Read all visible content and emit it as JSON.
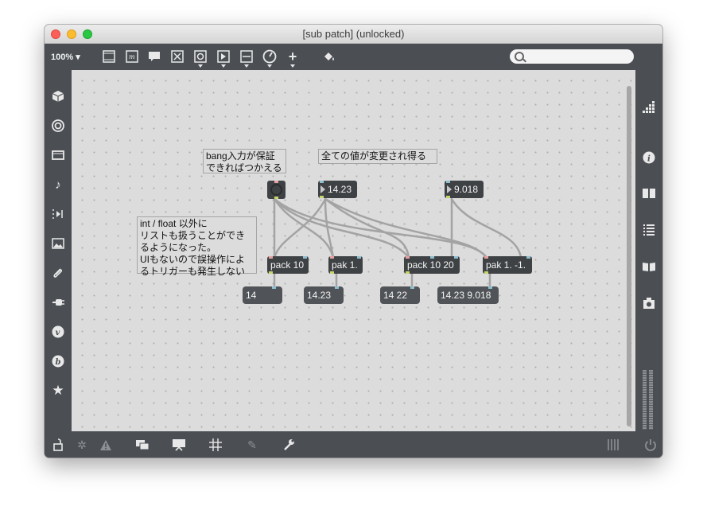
{
  "window": {
    "title": "[sub patch] (unlocked)"
  },
  "toolbar": {
    "zoom_label": "100%",
    "icons": [
      "presentation-view-icon",
      "message-object-icon",
      "comment-icon",
      "toggle-icon",
      "button-icon",
      "playbar-icon",
      "slider-icon",
      "dial-icon",
      "add-object-icon",
      "paint-bucket-icon"
    ],
    "search_placeholder": ""
  },
  "left_sidebar": {
    "icons": [
      "object-cube-icon",
      "circle-target-icon",
      "film-media-icon",
      "music-note-icon",
      "playlist-icon",
      "image-icon",
      "paperclip-icon",
      "plug-icon",
      "vizzie-icon",
      "beap-icon",
      "star-favorites-icon"
    ]
  },
  "right_sidebar": {
    "icons": [
      "grid-dots-icon",
      "info-icon",
      "reference-book-icon",
      "list-icon",
      "docs-book-icon",
      "snapshot-camera-icon"
    ]
  },
  "bottom_bar": {
    "icons": [
      "lock-icon",
      "debug-icon",
      "warning-icon",
      "window-stack-icon",
      "presentation-icon",
      "grid-icon",
      "edit-tag-icon",
      "wrench-icon",
      "mixer-icon",
      "power-icon"
    ]
  },
  "patch": {
    "comments": [
      {
        "id": "c1",
        "text": "bang入力が保証\nできればつかえる"
      },
      {
        "id": "c2",
        "text": "全ての値が変更され得る"
      },
      {
        "id": "c3",
        "text": "int / float 以外に\nリストも扱うことができ\nるようになった。\nUIもないので誤操作によ\nるトリガーも発生しない"
      }
    ],
    "objects": {
      "number_1": "14.23",
      "number_2": "9.018",
      "pack_10": "pack 10",
      "pak_1": "pak 1.",
      "pack_10_20": "pack 10 20",
      "pak_1_neg1": "pak 1. -1.",
      "msg_1": "14",
      "msg_2": "14.23",
      "msg_3": "14 22",
      "msg_4": "14.23 9.018"
    }
  },
  "colors": {
    "canvas": "#dcdcdc",
    "chrome": "#4b4f54",
    "object": "#3f4245",
    "cord": "#a8a8a8"
  }
}
